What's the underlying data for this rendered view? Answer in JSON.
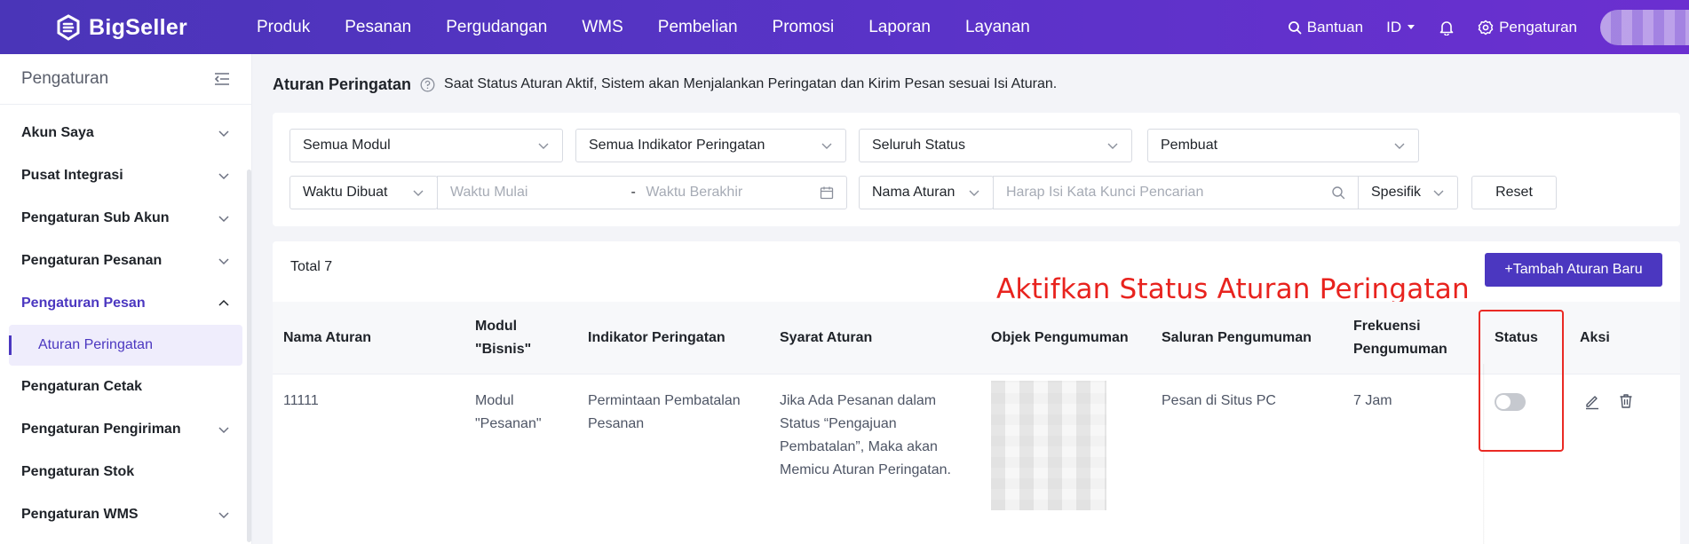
{
  "app": {
    "name": "BigSeller"
  },
  "nav": [
    "Produk",
    "Pesanan",
    "Pergudangan",
    "WMS",
    "Pembelian",
    "Promosi",
    "Laporan",
    "Layanan"
  ],
  "topRight": {
    "help": "Bantuan",
    "lang": "ID",
    "settings": "Pengaturan"
  },
  "sidebar": {
    "title": "Pengaturan",
    "items": [
      {
        "label": "Akun Saya"
      },
      {
        "label": "Pusat Integrasi"
      },
      {
        "label": "Pengaturan Sub Akun"
      },
      {
        "label": "Pengaturan Pesanan"
      },
      {
        "label": "Pengaturan Pesan"
      },
      {
        "label": "Aturan Peringatan"
      },
      {
        "label": "Pengaturan Cetak"
      },
      {
        "label": "Pengaturan Pengiriman"
      },
      {
        "label": "Pengaturan Stok"
      },
      {
        "label": "Pengaturan WMS"
      }
    ]
  },
  "page": {
    "title": "Aturan Peringatan",
    "desc": "Saat Status Aturan Aktif, Sistem akan Menjalankan Peringatan dan Kirim Pesan sesuai Isi Aturan."
  },
  "filters": {
    "module": "Semua Modul",
    "indicator": "Semua Indikator Peringatan",
    "status": "Seluruh Status",
    "creator": "Pembuat",
    "timeType": "Waktu Dibuat",
    "startPh": "Waktu Mulai",
    "dash": "-",
    "endPh": "Waktu Berakhir",
    "nameType": "Nama Aturan",
    "searchPh": "Harap Isi Kata Kunci Pencarian",
    "match": "Spesifik",
    "reset": "Reset"
  },
  "table": {
    "total": "Total 7",
    "addBtn": "+Tambah Aturan Baru",
    "annotation": "Aktifkan Status Aturan Peringatan",
    "headers": {
      "name": "Nama Aturan",
      "module1": "Modul",
      "module2": "\"Bisnis\"",
      "indicator": "Indikator Peringatan",
      "condition": "Syarat Aturan",
      "object": "Objek Pengumuman",
      "channel": "Saluran Pengumuman",
      "freq1": "Frekuensi",
      "freq2": "Pengumuman",
      "status": "Status",
      "actions": "Aksi"
    },
    "row": {
      "name": "11111",
      "module1": "Modul",
      "module2": "\"Pesanan\"",
      "indicator1": "Permintaan Pembatalan",
      "indicator2": "Pesanan",
      "cond1": "Jika Ada Pesanan dalam",
      "cond2": "Status “Pengajuan",
      "cond3": "Pembatalan”, Maka akan",
      "cond4": "Memicu Aturan Peringatan.",
      "channel": "Pesan di Situs PC",
      "freq": "7 Jam",
      "statusOn": false
    }
  },
  "colors": {
    "primary": "#4b37c0",
    "annotation": "#e8231e"
  }
}
